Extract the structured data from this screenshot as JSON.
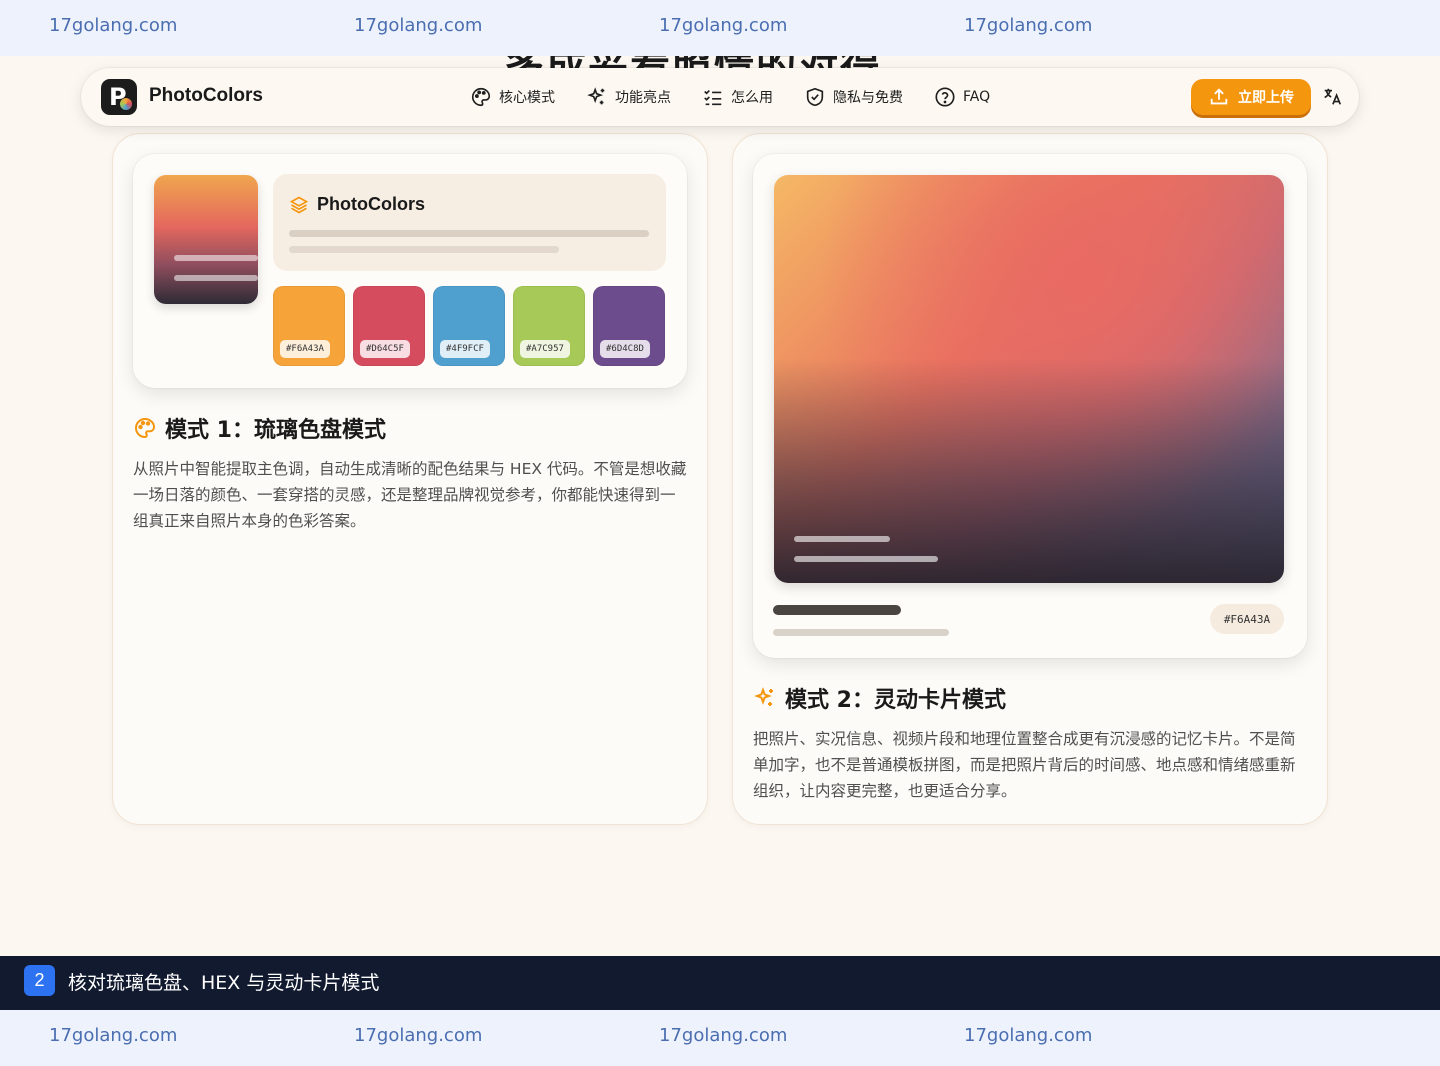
{
  "watermark": {
    "text": "17golang.com"
  },
  "section_heading_partial": "多成妥看照情的对得",
  "navbar": {
    "brand": "PhotoColors",
    "items": [
      {
        "label": "核心模式",
        "icon": "palette-icon"
      },
      {
        "label": "功能亮点",
        "icon": "sparkles-icon"
      },
      {
        "label": "怎么用",
        "icon": "checklist-icon"
      },
      {
        "label": "隐私与免费",
        "icon": "shield-icon"
      },
      {
        "label": "FAQ",
        "icon": "question-circle-icon"
      }
    ],
    "upload_label": "立即上传",
    "language_icon": "translate-icon"
  },
  "mode1": {
    "mock_title": "PhotoColors",
    "swatches": [
      {
        "hex": "#F6A43A",
        "color": "#f6a43a"
      },
      {
        "hex": "#D64C5F",
        "color": "#d64c5f"
      },
      {
        "hex": "#4F9FCF",
        "color": "#4f9fcf"
      },
      {
        "hex": "#A7C957",
        "color": "#a7c957"
      },
      {
        "hex": "#6D4C8D",
        "color": "#6d4c8d"
      }
    ],
    "title": "模式 1：琉璃色盘模式",
    "description": "从照片中智能提取主色调，自动生成清晰的配色结果与 HEX 代码。不管是想收藏一场日落的颜色、一套穿搭的灵感，还是整理品牌视觉参考，你都能快速得到一组真正来自照片本身的色彩答案。"
  },
  "mode2": {
    "hex_pill": "#F6A43A",
    "title": "模式 2：灵动卡片模式",
    "description": "把照片、实况信息、视频片段和地理位置整合成更有沉浸感的记忆卡片。不是简单加字，也不是普通模板拼图，而是把照片背后的时间感、地点感和情绪感重新组织，让内容更完整，也更适合分享。"
  },
  "caption": {
    "number": "2",
    "text": "核对琉璃色盘、HEX 与灵动卡片模式"
  },
  "colors": {
    "accent": "#f5960f",
    "caption_bg": "#121a30",
    "caption_num_bg": "#2d72f0"
  }
}
